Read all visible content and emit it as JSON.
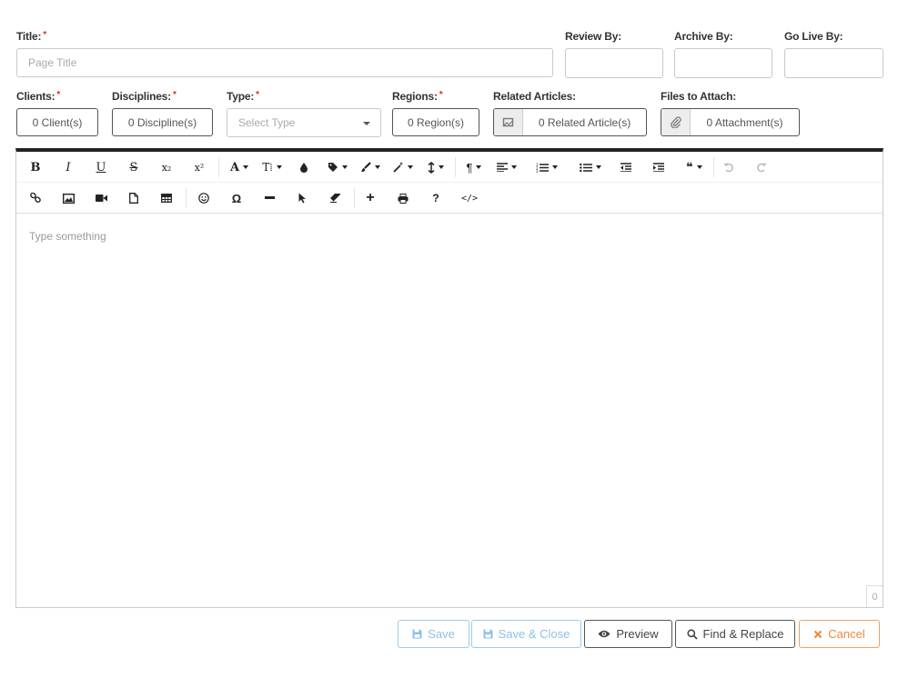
{
  "form": {
    "title": {
      "label": "Title:",
      "placeholder": "Page Title"
    },
    "review_by": {
      "label": "Review By:"
    },
    "archive_by": {
      "label": "Archive By:"
    },
    "go_live_by": {
      "label": "Go Live By:"
    },
    "clients": {
      "label": "Clients:",
      "value": "0 Client(s)"
    },
    "disciplines": {
      "label": "Disciplines:",
      "value": "0 Discipline(s)"
    },
    "type": {
      "label": "Type:",
      "placeholder": "Select Type"
    },
    "regions": {
      "label": "Regions:",
      "value": "0 Region(s)"
    },
    "related_articles": {
      "label": "Related Articles:",
      "value": "0 Related Article(s)"
    },
    "files": {
      "label": "Files to Attach:",
      "value": "0 Attachment(s)"
    },
    "required_mark": "*"
  },
  "editor": {
    "placeholder": "Type something",
    "char_count": "0",
    "toolbar_row1": [
      "bold",
      "italic",
      "underline",
      "strikethrough",
      "subscript",
      "superscript",
      "font-family",
      "font-size",
      "color",
      "paragraph-style",
      "inline-style",
      "clear-formatting",
      "line-height",
      "paragraph-format",
      "align",
      "ordered-list",
      "unordered-list",
      "outdent",
      "indent",
      "quote",
      "undo",
      "redo"
    ],
    "toolbar_row2": [
      "insert-link",
      "insert-image",
      "insert-video",
      "insert-file",
      "insert-table",
      "emoticons",
      "special-characters",
      "insert-hr",
      "select-all",
      "clear-formatting",
      "add",
      "print",
      "help",
      "code-view"
    ],
    "glyphs": {
      "bold": "B",
      "italic": "I",
      "underline": "U",
      "strike": "S",
      "sub": "x₂",
      "sup": "x²",
      "font": "A",
      "size": "T⁞",
      "para": "¶",
      "quote": "❝",
      "omega": "Ω",
      "help": "?",
      "code": "</>",
      "plus": "+"
    }
  },
  "buttons": {
    "save": "Save",
    "save_close": "Save & Close",
    "preview": "Preview",
    "find_replace": "Find & Replace",
    "cancel": "Cancel"
  },
  "colors": {
    "required": "#e02b27",
    "disabled_blue": "#8dc1e4",
    "cancel_orange": "#ee8a3c",
    "toolbar_border": "#222222"
  }
}
